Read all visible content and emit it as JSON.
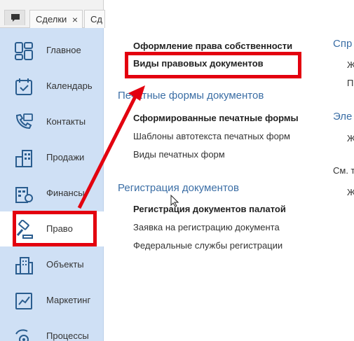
{
  "tabs": [
    {
      "label": "Сделки",
      "close": "×"
    },
    {
      "label": "Сд"
    }
  ],
  "sidebar": {
    "items": [
      {
        "label": "Главное",
        "icon": "dashboard-icon"
      },
      {
        "label": "Календарь",
        "icon": "calendar-icon"
      },
      {
        "label": "Контакты",
        "icon": "contacts-icon"
      },
      {
        "label": "Продажи",
        "icon": "building-icon"
      },
      {
        "label": "Финансы",
        "icon": "finance-icon"
      },
      {
        "label": "Право",
        "icon": "gavel-icon"
      },
      {
        "label": "Объекты",
        "icon": "objects-icon"
      },
      {
        "label": "Маркетинг",
        "icon": "chart-icon"
      },
      {
        "label": "Процессы",
        "icon": "process-icon"
      }
    ]
  },
  "main": {
    "top_commands": [
      {
        "label": "Оформление права собственности",
        "bold": true
      },
      {
        "label": "Виды правовых документов",
        "bold": true
      }
    ],
    "groups": [
      {
        "title": "Печатные формы документов",
        "commands": [
          {
            "label": "Сформированные печатные формы",
            "bold": true
          },
          {
            "label": "Шаблоны автотекста печатных форм",
            "bold": false
          },
          {
            "label": "Виды печатных форм",
            "bold": false
          }
        ]
      },
      {
        "title": "Регистрация документов",
        "commands": [
          {
            "label": "Регистрация документов палатой",
            "bold": true
          },
          {
            "label": "Заявка на регистрацию документа",
            "bold": false
          },
          {
            "label": "Федеральные службы регистрации",
            "bold": false
          }
        ]
      }
    ],
    "right_column": [
      "Спр",
      "Ж",
      "П",
      "Эле",
      "Ж",
      "См. т",
      "Ж"
    ]
  },
  "colors": {
    "sidebar_bg": "#cfe0f5",
    "group_title": "#3b6ea5",
    "annotation": "#e3000f"
  }
}
